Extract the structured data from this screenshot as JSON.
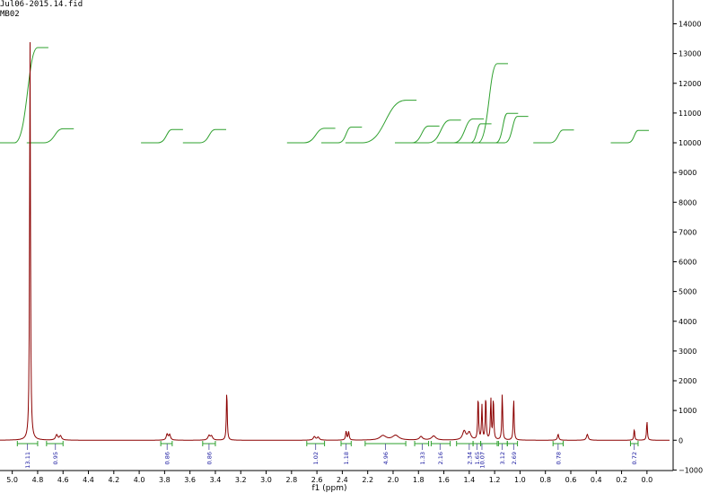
{
  "header": {
    "filename": "Jul06-2015.14.fid",
    "sample": "MB02"
  },
  "chart_data": {
    "type": "line",
    "title": "",
    "xlabel": "f1 (ppm)",
    "ylabel": "",
    "xlim": [
      5.04,
      -0.1
    ],
    "ylim": [
      -1200,
      14800
    ],
    "x_ticks": [
      "5.0",
      "4.8",
      "4.6",
      "4.4",
      "4.2",
      "4.0",
      "3.8",
      "3.6",
      "3.4",
      "3.2",
      "3.0",
      "2.8",
      "2.6",
      "2.4",
      "2.2",
      "2.0",
      "1.8",
      "1.6",
      "1.4",
      "1.2",
      "1.0",
      "0.8",
      "0.6",
      "0.4",
      "0.2",
      "0.0"
    ],
    "y_ticks": [
      "14000",
      "13000",
      "12000",
      "11000",
      "10000",
      "9000",
      "8000",
      "7000",
      "6000",
      "5000",
      "4000",
      "3000",
      "2000",
      "1000",
      "0",
      "-1000"
    ],
    "colors": {
      "spectrum": "#8b0000",
      "integral": "#2ea02e",
      "integral_label": "#1a1aa0"
    },
    "series": [
      {
        "peaks": [
          {
            "ppm": 4.86,
            "height": 13450,
            "width": 0.004
          },
          {
            "ppm": 4.65,
            "height": 180,
            "width": 0.01
          },
          {
            "ppm": 4.62,
            "height": 140,
            "width": 0.01
          },
          {
            "ppm": 3.78,
            "height": 200,
            "width": 0.008
          },
          {
            "ppm": 3.76,
            "height": 180,
            "width": 0.008
          },
          {
            "ppm": 3.45,
            "height": 150,
            "width": 0.01
          },
          {
            "ppm": 3.43,
            "height": 130,
            "width": 0.01
          },
          {
            "ppm": 3.31,
            "height": 1700,
            "width": 0.004
          },
          {
            "ppm": 2.62,
            "height": 120,
            "width": 0.01
          },
          {
            "ppm": 2.59,
            "height": 100,
            "width": 0.01
          },
          {
            "ppm": 2.37,
            "height": 300,
            "width": 0.005
          },
          {
            "ppm": 2.35,
            "height": 280,
            "width": 0.005
          },
          {
            "ppm": 2.08,
            "height": 150,
            "width": 0.03
          },
          {
            "ppm": 1.98,
            "height": 160,
            "width": 0.03
          },
          {
            "ppm": 1.78,
            "height": 120,
            "width": 0.015
          },
          {
            "ppm": 1.68,
            "height": 140,
            "width": 0.02
          },
          {
            "ppm": 1.44,
            "height": 300,
            "width": 0.015
          },
          {
            "ppm": 1.4,
            "height": 250,
            "width": 0.015
          },
          {
            "ppm": 1.33,
            "height": 1480,
            "width": 0.004
          },
          {
            "ppm": 1.3,
            "height": 1150,
            "width": 0.004
          },
          {
            "ppm": 1.27,
            "height": 1500,
            "width": 0.004
          },
          {
            "ppm": 1.23,
            "height": 1400,
            "width": 0.004
          },
          {
            "ppm": 1.21,
            "height": 1420,
            "width": 0.004
          },
          {
            "ppm": 1.14,
            "height": 1580,
            "width": 0.004
          },
          {
            "ppm": 1.05,
            "height": 1420,
            "width": 0.004
          },
          {
            "ppm": 0.7,
            "height": 200,
            "width": 0.006
          },
          {
            "ppm": 0.47,
            "height": 200,
            "width": 0.008
          },
          {
            "ppm": 0.1,
            "height": 380,
            "width": 0.004
          },
          {
            "ppm": 0.0,
            "height": 650,
            "width": 0.004
          }
        ]
      }
    ],
    "integrals": [
      {
        "label": "13.11",
        "from": 4.96,
        "to": 4.8,
        "center": 4.88
      },
      {
        "label": "0.95",
        "from": 4.73,
        "to": 4.6,
        "center": 4.66
      },
      {
        "label": "0.86",
        "from": 3.83,
        "to": 3.74,
        "center": 3.78
      },
      {
        "label": "0.86",
        "from": 3.5,
        "to": 3.4,
        "center": 3.45
      },
      {
        "label": "1.02",
        "from": 2.68,
        "to": 2.54,
        "center": 2.61
      },
      {
        "label": "1.18",
        "from": 2.41,
        "to": 2.33,
        "center": 2.37
      },
      {
        "label": "4.96",
        "from": 2.22,
        "to": 1.9,
        "center": 2.06
      },
      {
        "label": "1.33",
        "from": 1.83,
        "to": 1.72,
        "center": 1.77
      },
      {
        "label": "2.16",
        "from": 1.7,
        "to": 1.55,
        "center": 1.63
      },
      {
        "label": "2.34",
        "from": 1.5,
        "to": 1.37,
        "center": 1.4
      },
      {
        "label": "1.65",
        "from": 1.37,
        "to": 1.31,
        "center": 1.34
      },
      {
        "label": "10.07",
        "from": 1.31,
        "to": 1.18,
        "center": 1.3
      },
      {
        "label": "3.12",
        "from": 1.17,
        "to": 1.1,
        "center": 1.14
      },
      {
        "label": "2.69",
        "from": 1.1,
        "to": 1.02,
        "center": 1.05
      },
      {
        "label": "0.78",
        "from": 0.74,
        "to": 0.66,
        "center": 0.7
      },
      {
        "label": "0.72",
        "from": 0.13,
        "to": 0.07,
        "center": 0.1
      }
    ]
  }
}
